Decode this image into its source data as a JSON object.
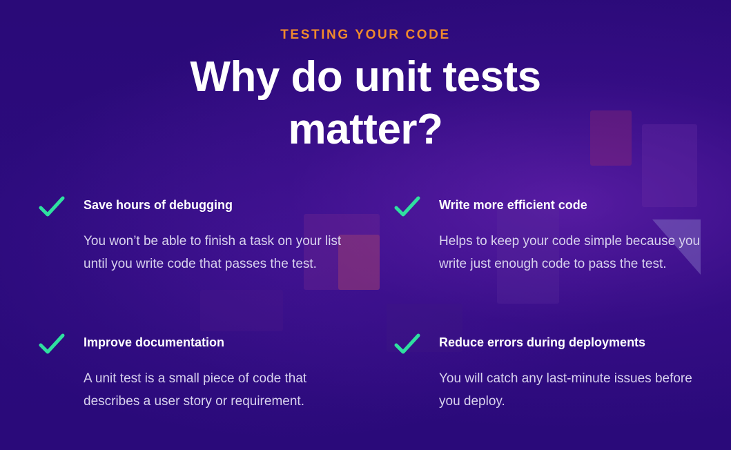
{
  "eyebrow": "TESTING YOUR CODE",
  "headline": {
    "line1": "Why do unit tests",
    "line2": "matter?"
  },
  "features": [
    {
      "icon": "check-icon",
      "title": "Save hours of debugging",
      "description": "You won’t be able to finish a task on your list until you write code that passes the test."
    },
    {
      "icon": "check-icon",
      "title": "Write more efficient code",
      "description": "Helps to keep your code simple because you write just enough code to pass the test."
    },
    {
      "icon": "check-icon",
      "title": "Improve documentation",
      "description": "A unit test is a small piece of code that describes a user story or requirement."
    },
    {
      "icon": "check-icon",
      "title": "Reduce errors during deployments",
      "description": "You will catch any last-minute issues before you deploy."
    }
  ],
  "colors": {
    "background": "#2b0b7a",
    "eyebrow": "#f08a2c",
    "check": "#2fe0a0",
    "headline": "#ffffff",
    "body_text": "#d8d2ee"
  }
}
